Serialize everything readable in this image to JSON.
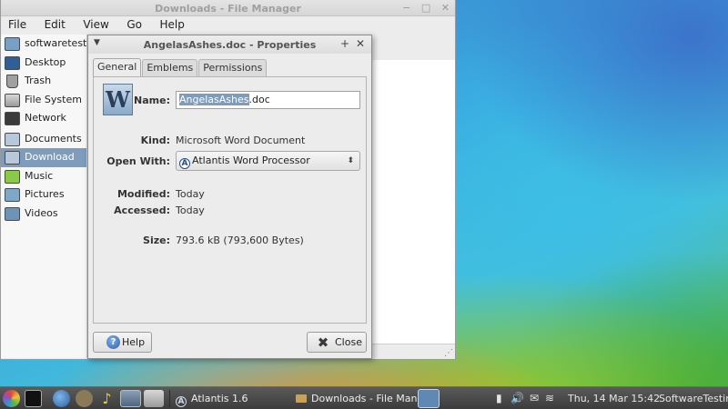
{
  "file_manager": {
    "title": "Downloads - File Manager",
    "menu": [
      "File",
      "Edit",
      "View",
      "Go",
      "Help"
    ],
    "sidebar": [
      {
        "label": "softwaretesting",
        "icon": "home-folder-icon"
      },
      {
        "label": "Desktop",
        "icon": "desktop-icon"
      },
      {
        "label": "Trash",
        "icon": "trash-icon"
      },
      {
        "label": "File System",
        "icon": "hard-drive-icon"
      },
      {
        "label": "Network",
        "icon": "network-icon"
      },
      {
        "label": "Documents",
        "icon": "folder-icon"
      },
      {
        "label": "Download",
        "icon": "download-folder-icon"
      },
      {
        "label": "Music",
        "icon": "music-folder-icon"
      },
      {
        "label": "Pictures",
        "icon": "pictures-folder-icon"
      },
      {
        "label": "Videos",
        "icon": "videos-folder-icon"
      }
    ],
    "active_sidebar": "Download"
  },
  "dialog": {
    "title": "AngelasAshes.doc - Properties",
    "tabs": [
      "General",
      "Emblems",
      "Permissions"
    ],
    "active_tab": "General",
    "file_icon_letter": "W",
    "name_label": "Name:",
    "name_selected": "AngelasAshes",
    "name_rest": ".doc",
    "kind_label": "Kind:",
    "kind_value": "Microsoft Word Document",
    "open_with_label": "Open With:",
    "open_with_badge": "A",
    "open_with_value": "Atlantis Word Processor",
    "modified_label": "Modified:",
    "modified_value": "Today",
    "accessed_label": "Accessed:",
    "accessed_value": "Today",
    "size_label": "Size:",
    "size_value": "793.6 kB (793,600 Bytes)",
    "help_label": "Help",
    "close_label": "Close"
  },
  "taskbar": {
    "tasks": [
      {
        "label": "Atlantis 1.6",
        "badge": "A"
      },
      {
        "label": "Downloads - File Man..."
      }
    ],
    "clock": "Thu, 14 Mar  15:42",
    "user": "SoftwareTesting"
  },
  "colors": {
    "selection": "#7f9cbc",
    "taskbar": "#4a4a4a"
  }
}
